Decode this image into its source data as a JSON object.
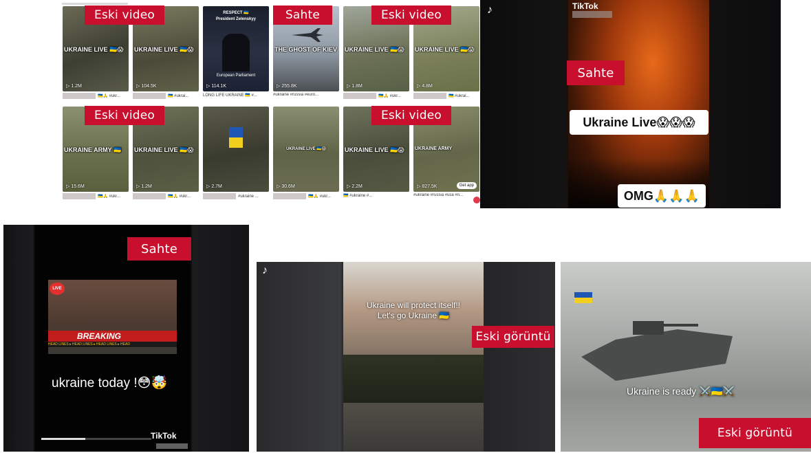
{
  "grid_collage": {
    "labels": {
      "eski_video_1": "Eski video",
      "sahte": "Sahte",
      "eski_video_2": "Eski video",
      "eski_video_3": "Eski video",
      "eski_video_4": "Eski video"
    },
    "row1": [
      {
        "caption": "UKRAINE LIVE 🇺🇦😱",
        "views": "▷ 1.2M",
        "tags": "🇺🇦🙏 #ukr..."
      },
      {
        "caption": "UKRAINE LIVE 🇺🇦😱",
        "views": "▷ 104.5K",
        "tags": "🇺🇦 #ukrai..."
      },
      {
        "caption_top": "RESPECT 🇺🇦\nPresident Zelenskyy",
        "caption_bottom": "European Parliament",
        "views": "▷ 114.1K",
        "tags": "LONG LIFE UKRAINE 🇺🇦 #..."
      },
      {
        "caption": "THE GHOST OF KIEV",
        "views": "▷ 255.8K",
        "tags": "#ukraine #russia #euro..."
      },
      {
        "caption": "UKRAINE LIVE 🇺🇦😱",
        "views": "▷ 1.8M",
        "tags": "🇺🇦🙏 #ukr..."
      },
      {
        "caption": "UKRAINE LIVE 🇺🇦😱",
        "views": "▷ 4.8M",
        "tags": "🇺🇦 #ukrai..."
      }
    ],
    "row2": [
      {
        "caption": "UKRAINE ARMY 🇺🇦",
        "views": "▷ 15.6M",
        "tags": "🇺🇦🙏 #ukr..."
      },
      {
        "caption": "UKRAINE LIVE 🇺🇦😱",
        "views": "▷ 1.2M",
        "tags": "🇺🇦🙏 #ukr..."
      },
      {
        "caption": "",
        "views": "▷ 2.7M",
        "tags": "#ukraine ..."
      },
      {
        "caption": "UKRAINE LIVE 🇺🇦😱",
        "views": "▷ 30.6M",
        "tags": "🇺🇦🙏 #ukr..."
      },
      {
        "caption": "UKRAINE LIVE 🇺🇦😱",
        "views": "▷ 2.2M",
        "tags": "🇺🇦 #ukraine #..."
      },
      {
        "caption": "UKRAINE ARMY",
        "views": "▷ 827.5K",
        "tags": "#ukraine #russia #usa #n...",
        "badge": "Get app"
      }
    ]
  },
  "video_explosion": {
    "brand": "TikTok",
    "label": "Sahte",
    "caption": "Ukraine Live😱😱😱",
    "caption2": "OMG🙏🙏🙏"
  },
  "video_breaking": {
    "label": "Sahte",
    "live_badge": "LIVE",
    "breaking": "BREAKING",
    "ticker": "HEAD LINES ▸ HEAD LINES ▸ HEAD LINES ▸ HEAD",
    "caption": "ukraine today !😳🤯",
    "brand": "TikTok"
  },
  "video_parade": {
    "caption": "Ukraine will protect itself!!\nLet's go Ukraine 🇺🇦",
    "label": "Eski görüntü"
  },
  "video_tank": {
    "caption": "Ukraine is ready ⚔️🇺🇦⚔️",
    "label": "Eski görüntü"
  },
  "colors": {
    "label_red": "#c8102e",
    "video_dark": "#0e0e10",
    "explosion_orange": "#e86a1a"
  }
}
